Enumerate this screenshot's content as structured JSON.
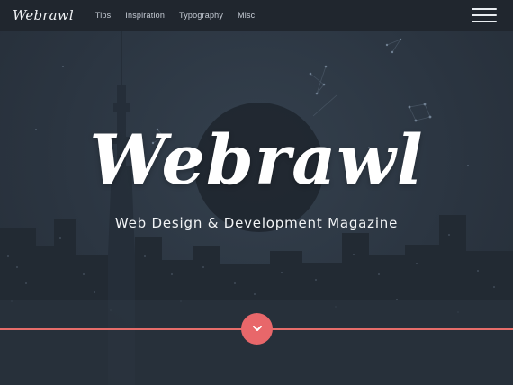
{
  "nav": {
    "logo": "Webrawl",
    "links": [
      "Tips",
      "Inspiration",
      "Typography",
      "Misc"
    ],
    "menu_icon": "hamburger-menu-icon"
  },
  "hero": {
    "title": "Webrawl",
    "subtitle": "Web Design & Development Magazine",
    "scroll_icon": "chevron-down-icon"
  },
  "colors": {
    "navbar": "#20262e",
    "background": "#2b3440",
    "accent": "#e8676a",
    "text": "#ffffff"
  }
}
